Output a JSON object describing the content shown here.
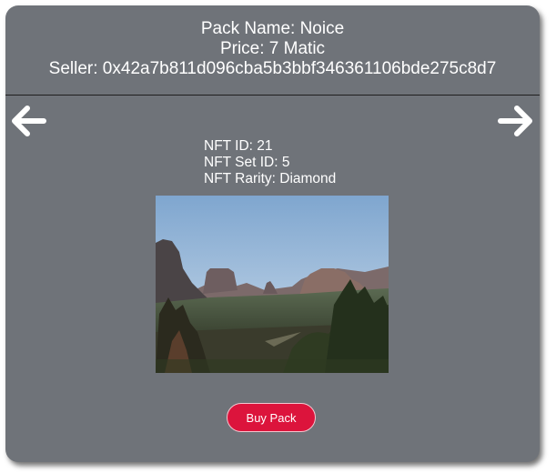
{
  "pack": {
    "name_line": "Pack Name: Noice",
    "price_line": "Price: 7 Matic",
    "seller_line": "Seller: 0x42a7b811d096cba5b3bbf346361106bde275c8d7"
  },
  "nft": {
    "id_line": "NFT ID: 21",
    "set_id_line": "NFT Set ID: 5",
    "rarity_line": "NFT Rarity: Diamond"
  },
  "navigation": {
    "prev_icon": "arrow-left-icon",
    "next_icon": "arrow-right-icon"
  },
  "actions": {
    "buy_label": "Buy Pack"
  },
  "colors": {
    "card_background": "#6f7379",
    "buy_button": "#dc143c",
    "text": "#ffffff"
  }
}
